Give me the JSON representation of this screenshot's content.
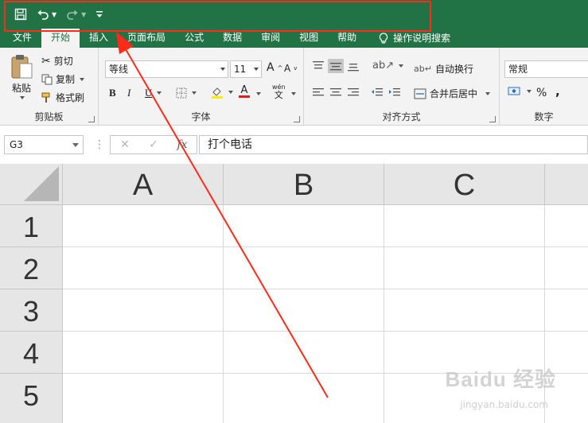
{
  "colors": {
    "brand": "#217346",
    "ribbon_bg": "#f3f3f3",
    "annotation": "#ff2a1a"
  },
  "qat": {
    "save_icon": "save-icon",
    "undo_icon": "undo-icon",
    "redo_icon": "redo-icon",
    "customize_icon": "customize-qat-icon"
  },
  "tabs": [
    {
      "label": "文件"
    },
    {
      "label": "开始"
    },
    {
      "label": "插入"
    },
    {
      "label": "页面布局"
    },
    {
      "label": "公式"
    },
    {
      "label": "数据"
    },
    {
      "label": "审阅"
    },
    {
      "label": "视图"
    },
    {
      "label": "帮助"
    }
  ],
  "search_tab": {
    "label": "操作说明搜索",
    "icon": "lightbulb-icon"
  },
  "ribbon": {
    "clipboard": {
      "paste": "粘贴",
      "cut": "剪切",
      "copy": "复制",
      "format_painter": "格式刷",
      "label": "剪贴板"
    },
    "font": {
      "font_name": "等线",
      "font_size": "11",
      "grow": "A",
      "shrink": "A",
      "bold": "B",
      "italic": "I",
      "underline": "U",
      "color_a": "A",
      "wen": "wén",
      "wen_char": "文",
      "label": "字体"
    },
    "alignment": {
      "wrap_text": "自动换行",
      "merge_center": "合并后居中",
      "label": "对齐方式"
    },
    "number": {
      "format": "常规",
      "percent": "%",
      "comma": ",",
      "label": "数字"
    }
  },
  "formula_bar": {
    "name_box": "G3",
    "cancel": "✕",
    "enter": "✓",
    "fx": "fx",
    "content": "打个电话"
  },
  "columns": [
    "A",
    "B",
    "C"
  ],
  "rows": [
    "1",
    "2",
    "3",
    "4",
    "5"
  ],
  "watermark": {
    "text": "Baidu 经验",
    "sub": "jingyan.baidu.com"
  }
}
